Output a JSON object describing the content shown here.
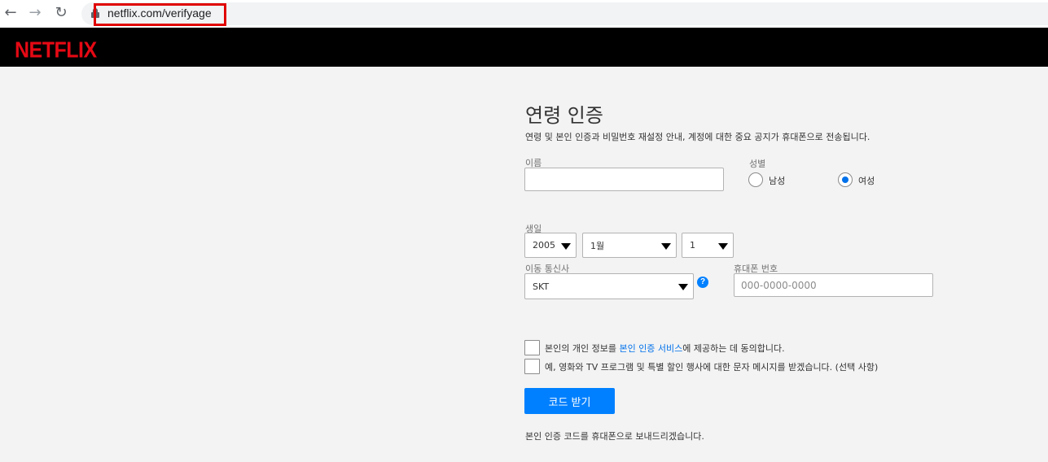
{
  "browser": {
    "url": "netflix.com/verifyage",
    "back_glyph": "←",
    "forward_glyph": "→",
    "reload_glyph": "↻"
  },
  "header": {
    "logo": "NETFLIX",
    "logo_color": "#e50914"
  },
  "form": {
    "title": "연령 인증",
    "subtitle": "연령 및 본인 인증과 비밀번호 재설정 안내, 계정에 대한 중요 공지가 휴대폰으로 전송됩니다.",
    "name": {
      "label": "이름",
      "value": ""
    },
    "gender": {
      "label": "성별",
      "options": [
        {
          "label": "남성",
          "checked": false
        },
        {
          "label": "여성",
          "checked": true
        }
      ]
    },
    "birthday": {
      "label": "생일",
      "year": "2005",
      "month": "1월",
      "day": "1"
    },
    "carrier": {
      "label": "이동 통신사",
      "value": "SKT",
      "help": "?"
    },
    "phone": {
      "label": "휴대폰 번호",
      "placeholder": "000-0000-0000"
    },
    "consent": {
      "prefix": "본인의 개인 정보를 ",
      "link": "본인 인증 서비스",
      "suffix": "에 제공하는 데 동의합니다."
    },
    "marketing": "예, 영화와 TV 프로그램 및 특별 할인 행사에 대한 문자 메시지를 받겠습니다. (선택 사항)",
    "submit_label": "코드 받기",
    "footnote": "본인 인증 코드를 휴대폰으로 보내드리겠습니다.",
    "accent_color": "#0080ff"
  }
}
